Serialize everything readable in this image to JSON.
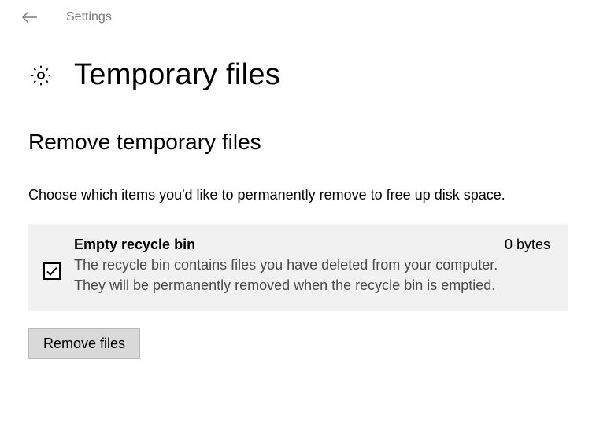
{
  "header": {
    "back_label": "Back",
    "app_label": "Settings"
  },
  "page": {
    "title": "Temporary files",
    "section_heading": "Remove temporary files",
    "section_desc": "Choose which items you'd like to permanently remove to free up disk space."
  },
  "items": [
    {
      "title": "Empty recycle bin",
      "size": "0 bytes",
      "desc": "The recycle bin contains files you have deleted from your computer. They will be permanently removed when the recycle bin is emptied.",
      "checked": true
    }
  ],
  "actions": {
    "remove_label": "Remove files"
  }
}
